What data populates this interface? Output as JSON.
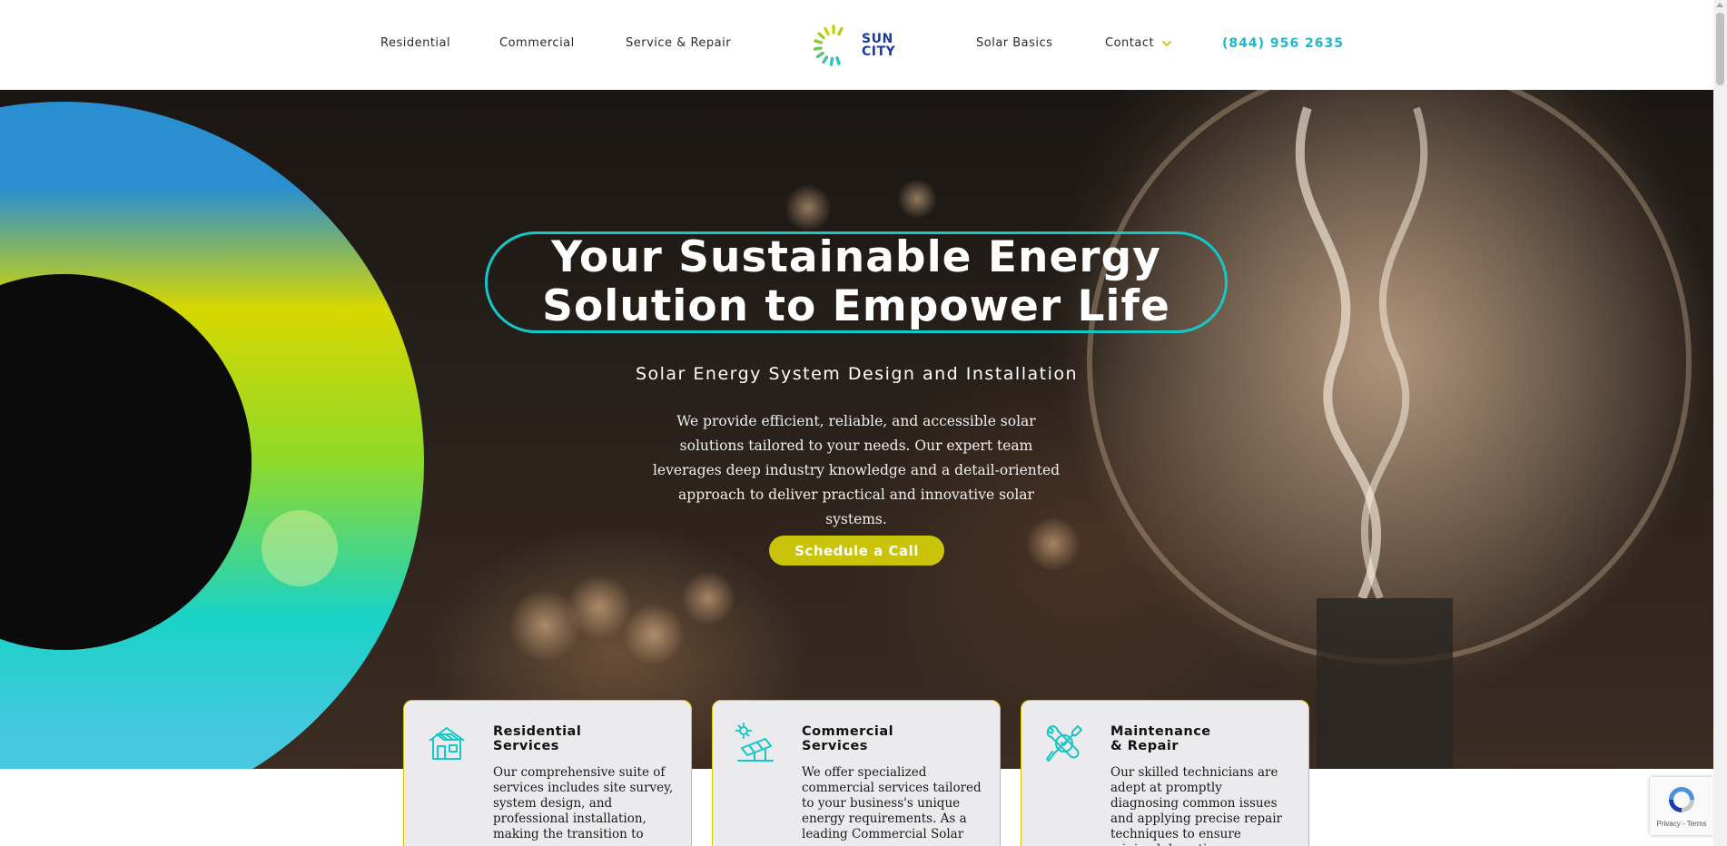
{
  "colors": {
    "accent_teal": "#14c8c8",
    "brand_blue": "#1a3aa0",
    "cta_yellow": "#c9c40a",
    "phone_teal": "#1fb8c9",
    "chevron_yellow": "#c9c40a",
    "card_border": "#d2c800"
  },
  "nav": {
    "left": [
      {
        "label": "Residential"
      },
      {
        "label": "Commercial"
      },
      {
        "label": "Service & Repair"
      }
    ],
    "right": [
      {
        "label": "Solar Basics"
      },
      {
        "label": "Contact"
      }
    ],
    "phone": "(844) 956 2635",
    "logo": {
      "line1": "SUN",
      "line2": "CITY",
      "icon": "sun-burst-icon"
    }
  },
  "hero": {
    "title_line1": "Your Sustainable Energy",
    "title_line2": "Solution to Empower Life",
    "subtitle": "Solar Energy System Design and Installation",
    "description": "We provide efficient, reliable, and accessible solar solutions tailored to your needs. Our expert team leverages deep industry knowledge and a detail-oriented approach to deliver practical and innovative solar systems.",
    "cta_label": "Schedule a Call"
  },
  "cards": [
    {
      "icon": "house-icon",
      "title_line1": "Residential",
      "title_line2": "Services",
      "text": "Our comprehensive suite of services includes site survey, system design, and professional installation, making the transition to"
    },
    {
      "icon": "solar-panel-icon",
      "title_line1": "Commercial",
      "title_line2": "Services",
      "text": "We offer specialized commercial services tailored to your business's unique energy requirements. As a leading Commercial Solar"
    },
    {
      "icon": "wrench-screwdriver-icon",
      "title_line1": "Maintenance",
      "title_line2": "& Repair",
      "text": "Our skilled technicians are adept at promptly diagnosing common issues and applying precise repair techniques to ensure minimal downtime."
    }
  ],
  "recaptcha": {
    "privacy": "Privacy",
    "separator": " - ",
    "terms": "Terms",
    "icon": "recaptcha-icon"
  }
}
